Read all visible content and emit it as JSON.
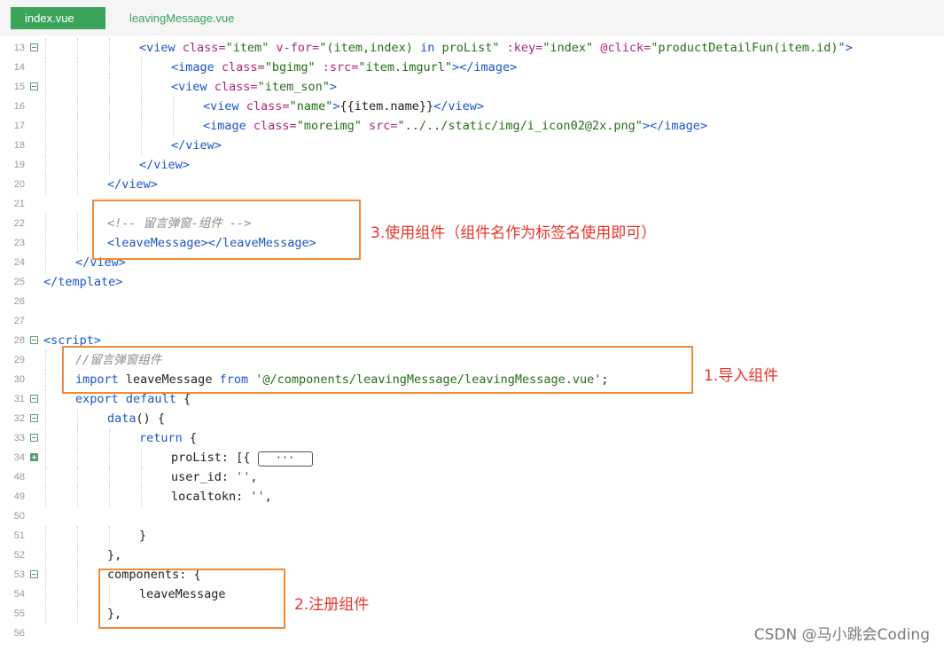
{
  "tabs": [
    {
      "label": "index.vue",
      "active": true
    },
    {
      "label": "leavingMessage.vue",
      "active": false
    }
  ],
  "lines": [
    {
      "n": "13",
      "fold": "minus",
      "indent": 3,
      "tokens": [
        [
          "tg",
          "<view "
        ],
        [
          "at",
          "class="
        ],
        [
          "st",
          "\"item\""
        ],
        [
          "tx",
          " "
        ],
        [
          "at",
          "v-for="
        ],
        [
          "st",
          "\"(item,index) "
        ],
        [
          "kw",
          "in"
        ],
        [
          "st",
          " proList\""
        ],
        [
          "tx",
          " "
        ],
        [
          "at",
          ":key="
        ],
        [
          "st",
          "\"index\""
        ],
        [
          "tx",
          " "
        ],
        [
          "at",
          "@click="
        ],
        [
          "st",
          "\"productDetailFun(item.id)\""
        ],
        [
          "tg",
          ">"
        ]
      ]
    },
    {
      "n": "14",
      "fold": "",
      "indent": 4,
      "tokens": [
        [
          "tg",
          "<image "
        ],
        [
          "at",
          "class="
        ],
        [
          "st",
          "\"bgimg\""
        ],
        [
          "tx",
          " "
        ],
        [
          "at",
          ":src="
        ],
        [
          "st",
          "\"item.imgurl\""
        ],
        [
          "tg",
          "></image>"
        ]
      ]
    },
    {
      "n": "15",
      "fold": "minus",
      "indent": 4,
      "tokens": [
        [
          "tg",
          "<view "
        ],
        [
          "at",
          "class="
        ],
        [
          "st",
          "\"item_son\""
        ],
        [
          "tg",
          ">"
        ]
      ]
    },
    {
      "n": "16",
      "fold": "",
      "indent": 5,
      "tokens": [
        [
          "tg",
          "<view "
        ],
        [
          "at",
          "class="
        ],
        [
          "st",
          "\"name\""
        ],
        [
          "tg",
          ">"
        ],
        [
          "mus",
          "{{item.name}}"
        ],
        [
          "tg",
          "</view>"
        ]
      ]
    },
    {
      "n": "17",
      "fold": "",
      "indent": 5,
      "tokens": [
        [
          "tg",
          "<image "
        ],
        [
          "at",
          "class="
        ],
        [
          "st",
          "\"moreimg\""
        ],
        [
          "tx",
          " "
        ],
        [
          "at",
          "src="
        ],
        [
          "st",
          "\"../../static/img/i_icon02@2x.png\""
        ],
        [
          "tg",
          "></image>"
        ]
      ]
    },
    {
      "n": "18",
      "fold": "",
      "indent": 4,
      "tokens": [
        [
          "tg",
          "</view>"
        ]
      ]
    },
    {
      "n": "19",
      "fold": "",
      "indent": 3,
      "tokens": [
        [
          "tg",
          "</view>"
        ]
      ]
    },
    {
      "n": "20",
      "fold": "",
      "indent": 2,
      "tokens": [
        [
          "tg",
          "</view>"
        ]
      ]
    },
    {
      "n": "21",
      "fold": "",
      "indent": 0,
      "tokens": []
    },
    {
      "n": "22",
      "fold": "",
      "indent": 2,
      "tokens": [
        [
          "cm",
          "<!-- 留言弹窗-组件 -->"
        ]
      ]
    },
    {
      "n": "23",
      "fold": "",
      "indent": 2,
      "tokens": [
        [
          "tg",
          "<leaveMessage></leaveMessage>"
        ]
      ]
    },
    {
      "n": "24",
      "fold": "",
      "indent": 1,
      "tokens": [
        [
          "tg",
          "</view>"
        ]
      ]
    },
    {
      "n": "25",
      "fold": "",
      "indent": 0,
      "tokens": [
        [
          "tg",
          "</template>"
        ]
      ]
    },
    {
      "n": "26",
      "fold": "",
      "indent": 0,
      "tokens": []
    },
    {
      "n": "27",
      "fold": "",
      "indent": 0,
      "tokens": []
    },
    {
      "n": "28",
      "fold": "minus",
      "indent": 0,
      "tokens": [
        [
          "tg",
          "<script>"
        ]
      ]
    },
    {
      "n": "29",
      "fold": "",
      "indent": 1,
      "tokens": [
        [
          "cm",
          "//留言弹窗组件"
        ]
      ]
    },
    {
      "n": "30",
      "fold": "",
      "indent": 1,
      "tokens": [
        [
          "kw",
          "import"
        ],
        [
          "tx",
          " leaveMessage "
        ],
        [
          "kw",
          "from"
        ],
        [
          "tx",
          " "
        ],
        [
          "st",
          "'@/components/leavingMessage/leavingMessage.vue'"
        ],
        [
          "tx",
          ";"
        ]
      ]
    },
    {
      "n": "31",
      "fold": "minus",
      "indent": 1,
      "tokens": [
        [
          "kw",
          "export"
        ],
        [
          "tx",
          " "
        ],
        [
          "kw",
          "default"
        ],
        [
          "tx",
          " {"
        ]
      ]
    },
    {
      "n": "32",
      "fold": "minus",
      "indent": 2,
      "tokens": [
        [
          "fn",
          "data"
        ],
        [
          "tx",
          "() {"
        ]
      ]
    },
    {
      "n": "33",
      "fold": "minus",
      "indent": 3,
      "tokens": [
        [
          "kw",
          "return"
        ],
        [
          "tx",
          " {"
        ]
      ]
    },
    {
      "n": "34",
      "fold": "plus",
      "indent": 4,
      "tokens": [
        [
          "tx",
          "proList: [{ "
        ],
        [
          "pill",
          "···"
        ]
      ]
    },
    {
      "n": "48",
      "fold": "",
      "indent": 4,
      "tokens": [
        [
          "tx",
          "user_id: "
        ],
        [
          "st",
          "''"
        ],
        [
          "tx",
          ","
        ]
      ]
    },
    {
      "n": "49",
      "fold": "",
      "indent": 4,
      "tokens": [
        [
          "tx",
          "localtokn: "
        ],
        [
          "st",
          "''"
        ],
        [
          "tx",
          ","
        ]
      ]
    },
    {
      "n": "50",
      "fold": "",
      "indent": 0,
      "tokens": []
    },
    {
      "n": "51",
      "fold": "",
      "indent": 3,
      "tokens": [
        [
          "tx",
          "}"
        ]
      ]
    },
    {
      "n": "52",
      "fold": "",
      "indent": 2,
      "tokens": [
        [
          "tx",
          "},"
        ]
      ]
    },
    {
      "n": "53",
      "fold": "minus",
      "indent": 2,
      "tokens": [
        [
          "tx",
          "components: {"
        ]
      ]
    },
    {
      "n": "54",
      "fold": "",
      "indent": 3,
      "tokens": [
        [
          "tx",
          "leaveMessage"
        ]
      ]
    },
    {
      "n": "55",
      "fold": "",
      "indent": 2,
      "tokens": [
        [
          "tx",
          "},"
        ]
      ]
    },
    {
      "n": "56",
      "fold": "",
      "indent": 0,
      "tokens": []
    }
  ],
  "annotations": [
    {
      "label": "3.使用组件（组件名作为标签名使用即可）"
    },
    {
      "label": "1.导入组件"
    },
    {
      "label": "2.注册组件"
    }
  ],
  "watermark": "CSDN @马小跳会Coding",
  "colors": {
    "accent": "#3ba55c",
    "highlight": "#ef8b3a",
    "annotation": "#e8332a"
  }
}
